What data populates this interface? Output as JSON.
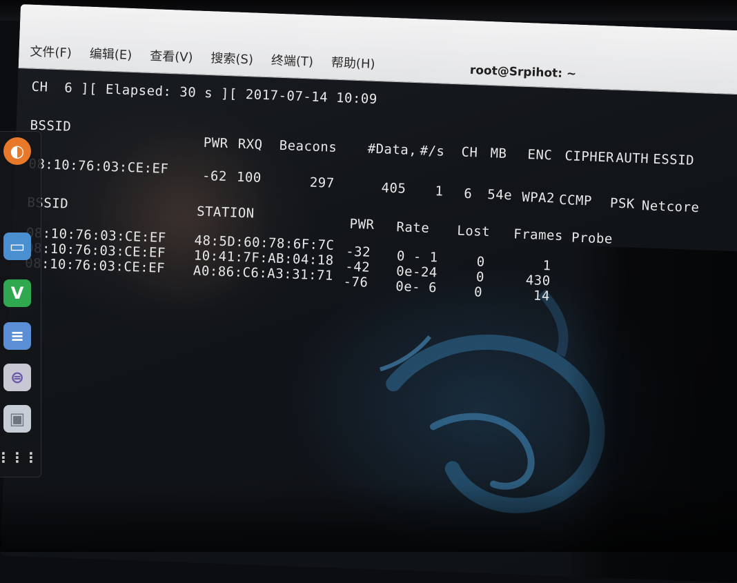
{
  "window": {
    "title": "root@Srpihot: ~"
  },
  "menu": [
    {
      "label": "文件(F)"
    },
    {
      "label": "编辑(E)"
    },
    {
      "label": "查看(V)"
    },
    {
      "label": "搜索(S)"
    },
    {
      "label": "终端(T)"
    },
    {
      "label": "帮助(H)"
    }
  ],
  "terminal": {
    "status_line": "CH  6 ][ Elapsed: 30 s ][ 2017-07-14 10:09",
    "ap_table": {
      "headers": {
        "bssid": "BSSID",
        "pwr": "PWR",
        "rxq": "RXQ",
        "beacons": "Beacons",
        "data": "#Data,",
        "per_s": "#/s",
        "ch": "CH",
        "mb": "MB",
        "enc": "ENC",
        "cipher": "CIPHER",
        "auth": "AUTH",
        "essid": "ESSID"
      },
      "rows": [
        {
          "bssid": "08:10:76:03:CE:EF",
          "pwr": "-62",
          "rxq": "100",
          "beacons": "297",
          "data": "405",
          "per_s": "1",
          "ch": "6",
          "mb": "54e",
          "enc": "WPA2",
          "cipher": "CCMP",
          "auth": "PSK",
          "essid": "Netcore"
        }
      ]
    },
    "station_table": {
      "headers": {
        "bssid": "BSSID",
        "station": "STATION",
        "pwr": "PWR",
        "rate": "Rate",
        "lost": "Lost",
        "frames": "Frames",
        "probe": "Probe"
      },
      "rows": [
        {
          "bssid": "08:10:76:03:CE:EF",
          "station": "48:5D:60:78:6F:7C",
          "pwr": "-32",
          "rate": "0 - 1",
          "lost": "0",
          "frames": "1"
        },
        {
          "bssid": "08:10:76:03:CE:EF",
          "station": "10:41:7F:AB:04:18",
          "pwr": "-42",
          "rate": "0e-24",
          "lost": "0",
          "frames": "430"
        },
        {
          "bssid": "08:10:76:03:CE:EF",
          "station": "A0:86:C6:A3:31:71",
          "pwr": "-76",
          "rate": "0e- 6",
          "lost": "0",
          "frames": "14"
        }
      ]
    }
  },
  "dock": [
    {
      "icon": "firefox-icon",
      "color": "#e8782a"
    },
    {
      "icon": "folder-icon",
      "color": "#4a8fd0"
    },
    {
      "icon": "vim-icon",
      "color": "#2fa84f"
    },
    {
      "icon": "text-editor-icon",
      "color": "#5a8fd6"
    },
    {
      "icon": "settings-toggle-icon",
      "color": "#9a8fd0"
    },
    {
      "icon": "screenshot-icon",
      "color": "#c7cdd6"
    },
    {
      "icon": "app-grid-icon",
      "color": "#d0d0d0"
    }
  ]
}
